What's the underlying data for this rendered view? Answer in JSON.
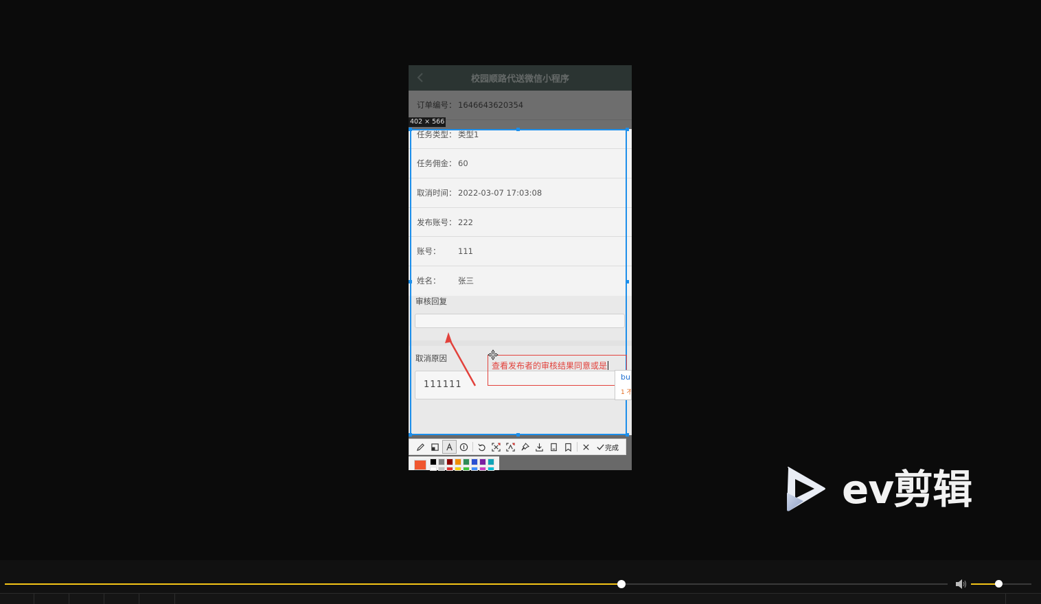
{
  "app": {
    "nav_title": "校园顺路代送微信小程序",
    "details": [
      {
        "label": "订单编号：",
        "value": "1646643620354"
      },
      {
        "label": "任务类型：",
        "value": "类型1"
      },
      {
        "label": "任务佣金：",
        "value": "60"
      },
      {
        "label": "取消时间：",
        "value": "2022-03-07 17:03:08"
      },
      {
        "label": "发布账号：",
        "value": "222"
      },
      {
        "label": "账号：",
        "value": "111"
      },
      {
        "label": "姓名：",
        "value": "张三"
      }
    ],
    "review_reply_label": "审核回复",
    "review_reply_value": "",
    "cancel_reason_label": "取消原因",
    "cancel_reason_value": "111111"
  },
  "capture": {
    "size_label": "402 × 566",
    "annotation_text": "查看发布者的审核结果同意或是",
    "ime_candidate_input": "bu",
    "ime_candidate_first": "1 不",
    "done_label": "完成",
    "current_color": "#f0562e",
    "tool_icons": [
      "pencil-icon",
      "mosaic-icon",
      "text-icon",
      "number-icon",
      "undo-icon",
      "ocr-icon",
      "translate-icon",
      "pin-icon",
      "download-icon",
      "save-icon",
      "bookmark-icon",
      "close-icon",
      "check-icon"
    ],
    "palette_colors": [
      "#000000",
      "#808080",
      "#8b0000",
      "#f08c00",
      "#2e8b57",
      "#2a4fd1",
      "#7a1fa2",
      "#0fa3b8",
      "#ffffff",
      "#c0c0c0",
      "#e03030",
      "#f5d000",
      "#3cc33c",
      "#3c8cff",
      "#cc3cc3",
      "#00bcd4"
    ]
  },
  "watermark": {
    "brand": "ev剪辑"
  },
  "player": {
    "progress": 0.654,
    "volume": 0.45,
    "accent_color": "#f5c518"
  }
}
